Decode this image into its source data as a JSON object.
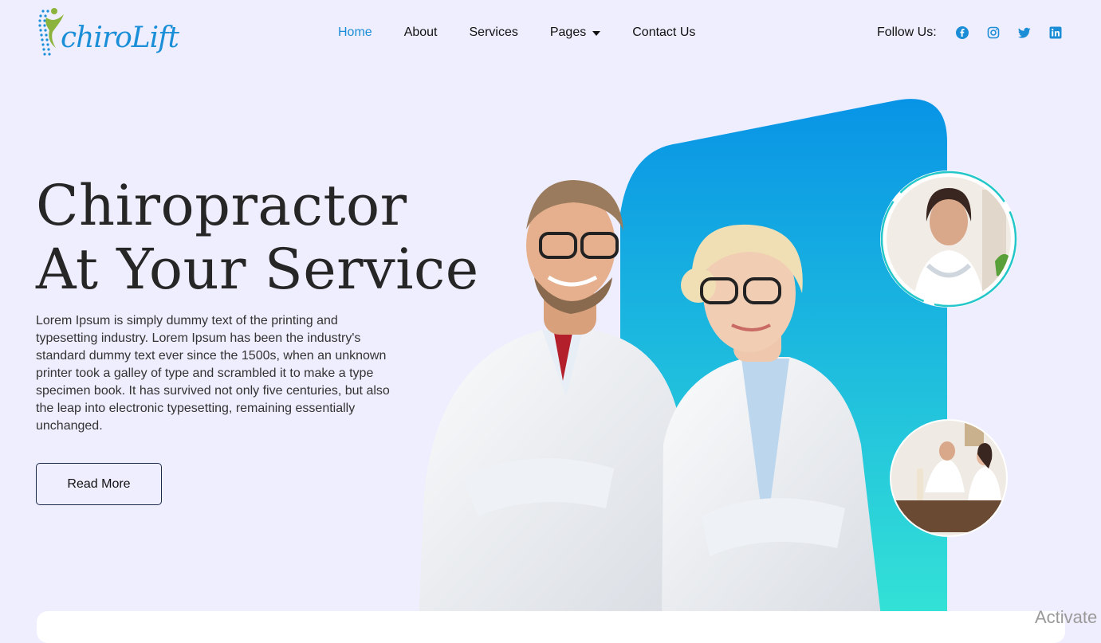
{
  "brand": {
    "name": "chiroLift",
    "primary_color": "#1b8dd6",
    "leaf_color": "#8cb43c"
  },
  "nav": {
    "items": [
      {
        "label": "Home",
        "active": true
      },
      {
        "label": "About"
      },
      {
        "label": "Services"
      },
      {
        "label": "Pages",
        "has_dropdown": true
      },
      {
        "label": "Contact Us"
      }
    ]
  },
  "follow": {
    "label": "Follow Us:",
    "icons": [
      "facebook-icon",
      "instagram-icon",
      "twitter-icon",
      "linkedin-icon"
    ]
  },
  "hero": {
    "title_line1": "Chiropractor",
    "title_line2": "At Your Service",
    "description": "Lorem Ipsum is simply dummy text of the printing and typesetting industry. Lorem Ipsum has been the industry's standard dummy text ever since the 1500s, when an unknown printer took a galley of type and scrambled it to make a type specimen book. It has survived not only five centuries, but also the leap into electronic typesetting, remaining essentially unchanged.",
    "button_label": "Read More",
    "gradient_top": "#0894e6",
    "gradient_bottom": "#34e3d6"
  },
  "watermark": {
    "text": "Activate"
  }
}
